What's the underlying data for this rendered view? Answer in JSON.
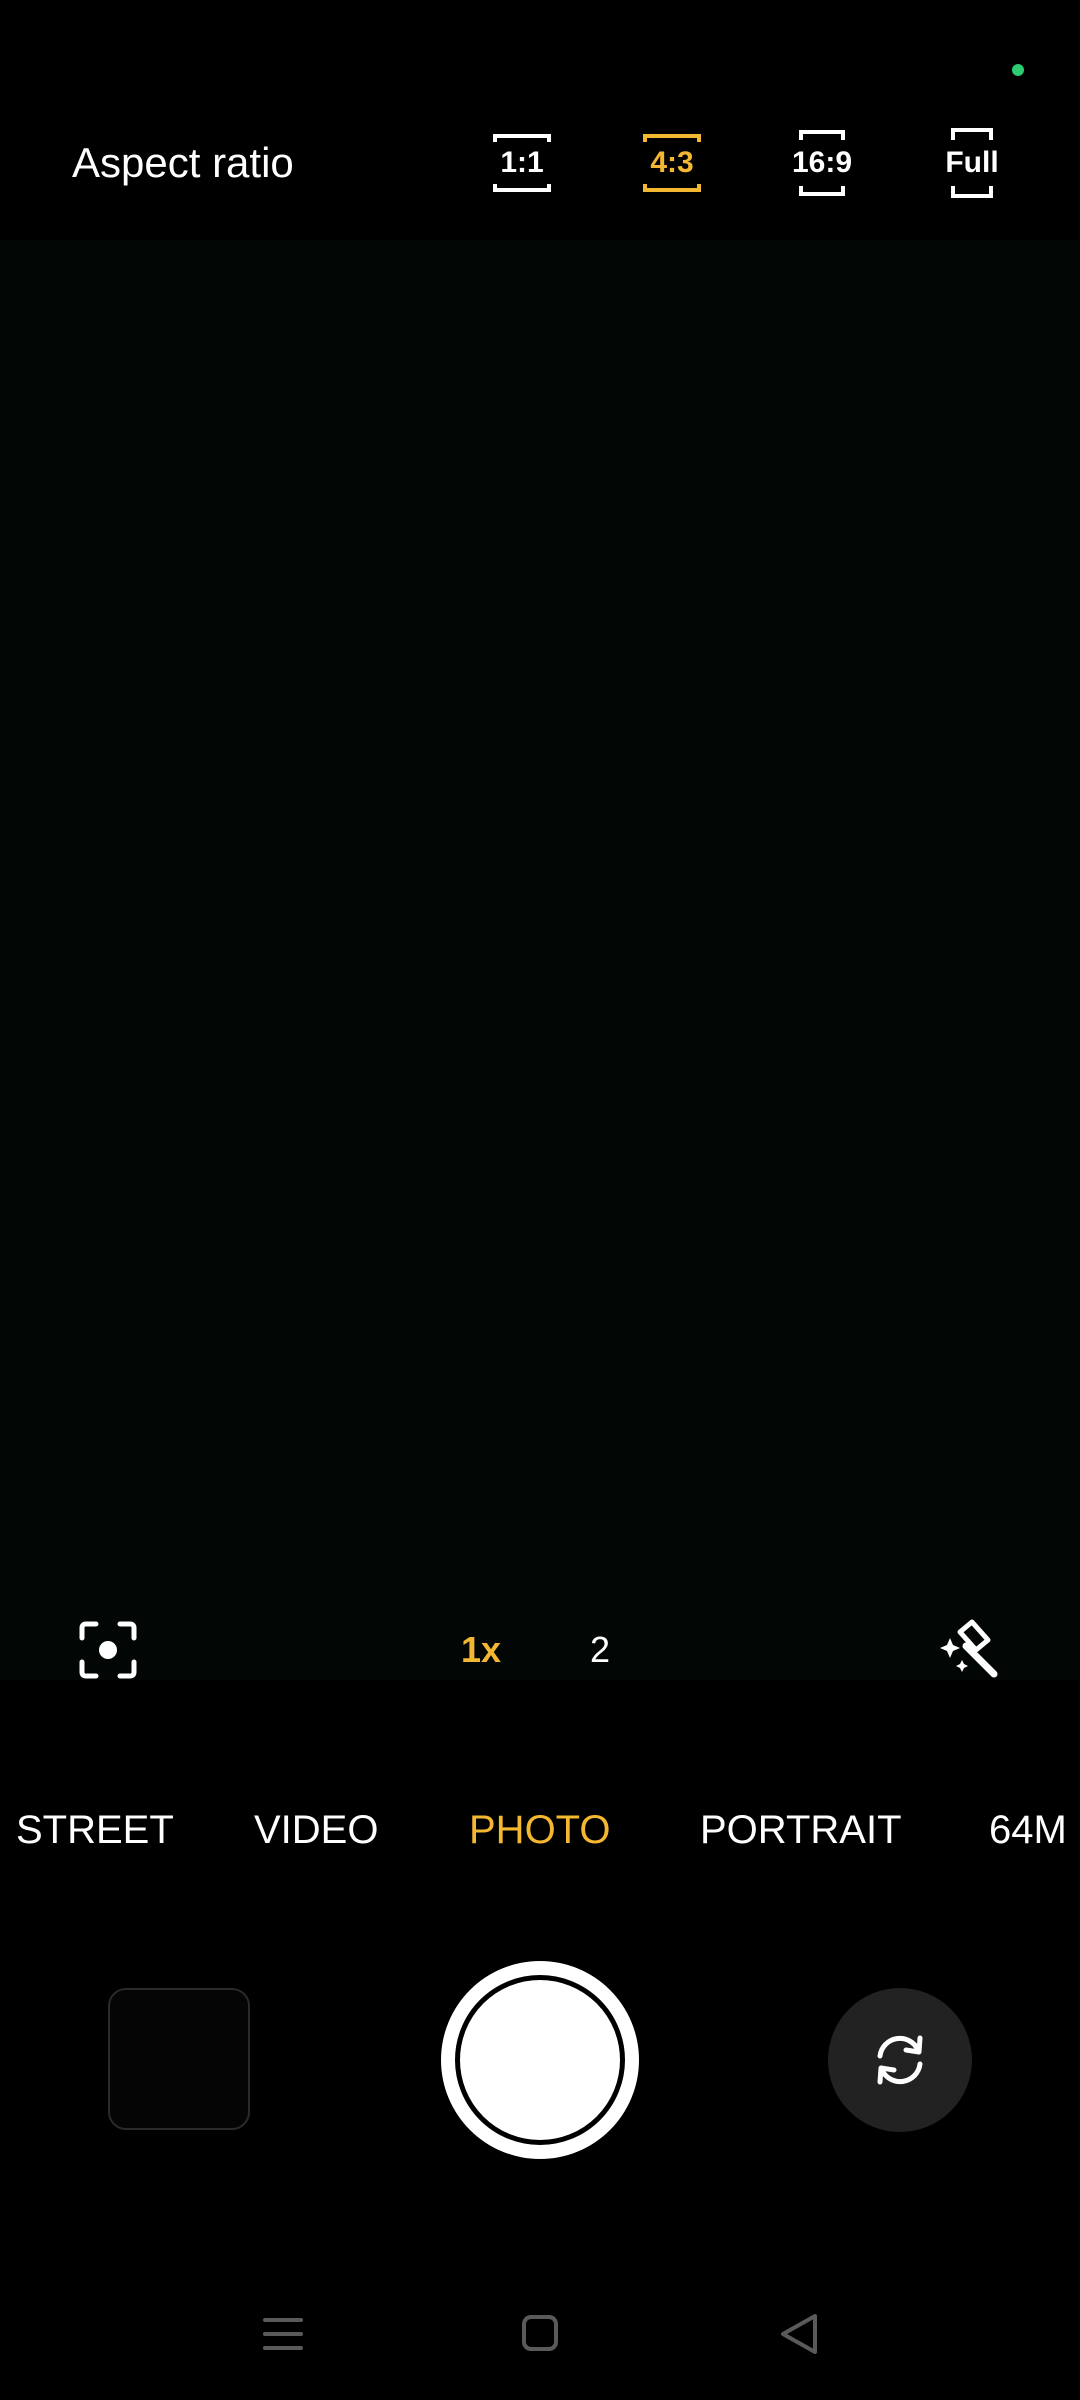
{
  "top_bar": {
    "label": "Aspect ratio",
    "ratios": [
      {
        "label": "1:1",
        "selected": false
      },
      {
        "label": "4:3",
        "selected": true
      },
      {
        "label": "16:9",
        "selected": false
      },
      {
        "label": "Full",
        "selected": false
      }
    ]
  },
  "zoom": {
    "levels": [
      {
        "label": "1x",
        "selected": true
      },
      {
        "label": "2",
        "selected": false
      }
    ]
  },
  "modes": [
    {
      "label": "STREET",
      "selected": false
    },
    {
      "label": "VIDEO",
      "selected": false
    },
    {
      "label": "PHOTO",
      "selected": true
    },
    {
      "label": "PORTRAIT",
      "selected": false
    },
    {
      "label": "64M",
      "selected": false
    }
  ],
  "icons": {
    "left_tool": "focus-lens-icon",
    "right_tool": "magic-wand-icon",
    "flip": "switch-camera-icon",
    "nav": [
      "menu-icon",
      "home-icon",
      "back-icon"
    ]
  },
  "colors": {
    "accent": "#f4b731",
    "background": "#000000",
    "viewfinder": "#020604",
    "privacy_indicator": "#2ecc71",
    "flip_button": "#222222"
  }
}
